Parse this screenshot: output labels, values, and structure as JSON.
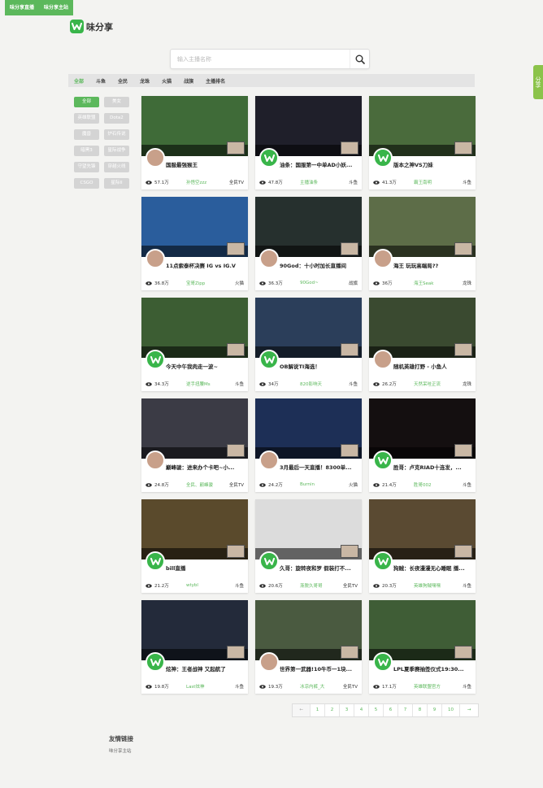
{
  "top_tabs": [
    "味分享直播",
    "味分享主站"
  ],
  "logo": {
    "text": "味分享",
    "icon": "w-logo-icon"
  },
  "share_tab": "分享",
  "search": {
    "placeholder": "输入主播名称",
    "icon": "search-icon"
  },
  "nav": [
    "全部",
    "斗鱼",
    "全民",
    "龙珠",
    "火猫",
    "战旗",
    "主播排名"
  ],
  "nav_active": 0,
  "tags": [
    "全部",
    "美女",
    "英雄联盟",
    "Dota2",
    "魔兽",
    "炉石传说",
    "暗黑3",
    "星际战争",
    "守望先锋",
    "穿越火线",
    "CSGO",
    "星际II"
  ],
  "cards": [
    {
      "title": "国服最强猴王",
      "views": "57.1万",
      "anchor": "孙悟空zzz",
      "platform": "全民TV",
      "thumb": "#3f6b38",
      "avatar": "photo"
    },
    {
      "title": "油条：国服第一中单AD小妖...",
      "views": "47.8万",
      "anchor": "主播油条",
      "platform": "斗鱼",
      "thumb": "#1f1f2a",
      "avatar": "logo"
    },
    {
      "title": "版本之神VS刀妹",
      "views": "41.3万",
      "anchor": "霸王南明",
      "platform": "斗鱼",
      "thumb": "#4a6b3c",
      "avatar": "logo"
    },
    {
      "title": "11点索泰杯决赛 IG vs IG.V",
      "views": "36.8万",
      "anchor": "宝哥Zipp",
      "platform": "火猫",
      "thumb": "#2a5d9c",
      "avatar": "photo"
    },
    {
      "title": "90God：十小时加长直播间",
      "views": "36.3万",
      "anchor": "90God~",
      "platform": "战旗",
      "thumb": "#26302e",
      "avatar": "photo"
    },
    {
      "title": "海王 玩玩高端局??",
      "views": "36万",
      "anchor": "海王Seak",
      "platform": "龙珠",
      "thumb": "#5d6d48",
      "avatar": "photo"
    },
    {
      "title": "今天中午我肉走一波~",
      "views": "34.3万",
      "anchor": "逆手扭腰Ms",
      "platform": "斗鱼",
      "thumb": "#3c5d33",
      "avatar": "logo"
    },
    {
      "title": "OB解说TI海选！",
      "views": "34万",
      "anchor": "820影响天",
      "platform": "斗鱼",
      "thumb": "#2b3e5a",
      "avatar": "logo"
    },
    {
      "title": "随机英雄打野 - 小鱼人",
      "views": "26.2万",
      "anchor": "天然呆哇正流",
      "platform": "龙珠",
      "thumb": "#3a4a30",
      "avatar": "photo"
    },
    {
      "title": "巅峰骏：进来办个卡吧~小...",
      "views": "24.8万",
      "anchor": "全民、巅峰骏",
      "platform": "全民TV",
      "thumb": "#3b3b45",
      "avatar": "photo"
    },
    {
      "title": "3月最后一天直播！8300单...",
      "views": "24.2万",
      "anchor": "Burnin",
      "platform": "火猫",
      "thumb": "#1d2f56",
      "avatar": "photo"
    },
    {
      "title": "胜哥：卢克RIAD十连发，...",
      "views": "21.4万",
      "anchor": "胜哥002",
      "platform": "斗鱼",
      "thumb": "#140f10",
      "avatar": "logo"
    },
    {
      "title": "bill直播",
      "views": "21.2万",
      "anchor": "wtybl",
      "platform": "斗鱼",
      "thumb": "#5a4a2c",
      "avatar": "logo"
    },
    {
      "title": "久哥：旋转夜和罗 假装打不...",
      "views": "20.6万",
      "anchor": "渐脱久哥哥",
      "platform": "全民TV",
      "thumb": "#dcdcdc",
      "avatar": "logo"
    },
    {
      "title": "狗贼：长夜漫漫无心睡眠 播...",
      "views": "20.3万",
      "anchor": "英雄狗贼嘿嘿",
      "platform": "斗鱼",
      "thumb": "#5a4a32",
      "avatar": "logo"
    },
    {
      "title": "炫神：王者战神 又起航了",
      "views": "19.8万",
      "anchor": "Last炫神",
      "platform": "斗鱼",
      "thumb": "#232a3a",
      "avatar": "logo"
    },
    {
      "title": "世界第一武器!10牛币一1块...",
      "views": "19.3万",
      "anchor": "冰凉内裤_大",
      "platform": "全民TV",
      "thumb": "#4a5a40",
      "avatar": "photo"
    },
    {
      "title": "LPL夏季赛抽签仪式19:30...",
      "views": "17.1万",
      "anchor": "英雄联盟官方",
      "platform": "斗鱼",
      "thumb": "#3f5d36",
      "avatar": "logo"
    }
  ],
  "pagination": {
    "prev": "←",
    "pages": [
      "1",
      "2",
      "3",
      "4",
      "5",
      "6",
      "7",
      "8",
      "9",
      "10"
    ],
    "next": "→"
  },
  "friendly_links": {
    "title": "友情链接",
    "items": [
      "味分享主站"
    ]
  },
  "colors": {
    "accent": "#5cb85c",
    "logo_green": "#39b54a",
    "background": "#f3f3f1"
  }
}
